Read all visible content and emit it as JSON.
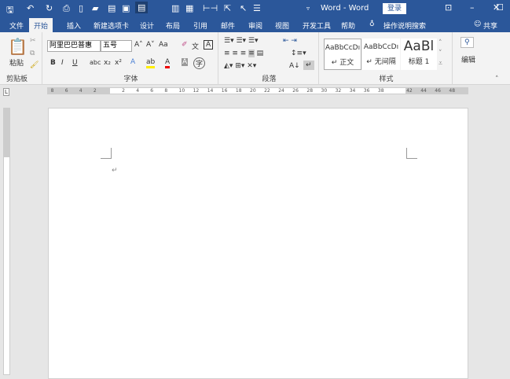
{
  "titlebar": {
    "title": "Word - Word",
    "login": "登录",
    "icons": [
      "save-icon",
      "undo-icon",
      "redo-icon",
      "print-preview-icon",
      "new-icon",
      "open-icon",
      "paste-icon",
      "screenshot-icon",
      "read-mode-icon",
      "columns-icon",
      "clipboard-icon",
      "margins-icon",
      "select-icon",
      "pointer-icon",
      "bullets-icon",
      "customize-icon"
    ]
  },
  "tabs": [
    "文件",
    "开始",
    "插入",
    "新建选项卡",
    "设计",
    "布局",
    "引用",
    "邮件",
    "审阅",
    "视图",
    "开发工具",
    "帮助"
  ],
  "active_tab": "开始",
  "search": "操作说明搜索",
  "share": "共享",
  "ribbon": {
    "clipboard": {
      "paste": "粘贴",
      "label": "剪贴板"
    },
    "font": {
      "name": "阿里巴巴普惠",
      "size": "五号",
      "label": "字体",
      "buttons": [
        "B",
        "I",
        "U",
        "abc",
        "x₂",
        "x²",
        "Aa"
      ]
    },
    "paragraph": {
      "label": "段落"
    },
    "styles": {
      "label": "样式",
      "items": [
        {
          "preview": "AaBbCcDı",
          "name": "↵ 正文"
        },
        {
          "preview": "AaBbCcDı",
          "name": "↵ 无间隔"
        },
        {
          "preview": "AaBl",
          "name": "标题 1"
        }
      ]
    },
    "editing": {
      "label": "编辑"
    }
  },
  "ruler": {
    "left": [
      "8",
      "6",
      "4",
      "2"
    ],
    "main": [
      "2",
      "4",
      "6",
      "8",
      "10",
      "12",
      "14",
      "16",
      "18",
      "20",
      "22",
      "24",
      "26",
      "28",
      "30",
      "32",
      "34",
      "36",
      "38"
    ],
    "right": [
      "42",
      "44",
      "46",
      "48"
    ]
  },
  "document": {
    "paragraph_mark": "↵"
  }
}
